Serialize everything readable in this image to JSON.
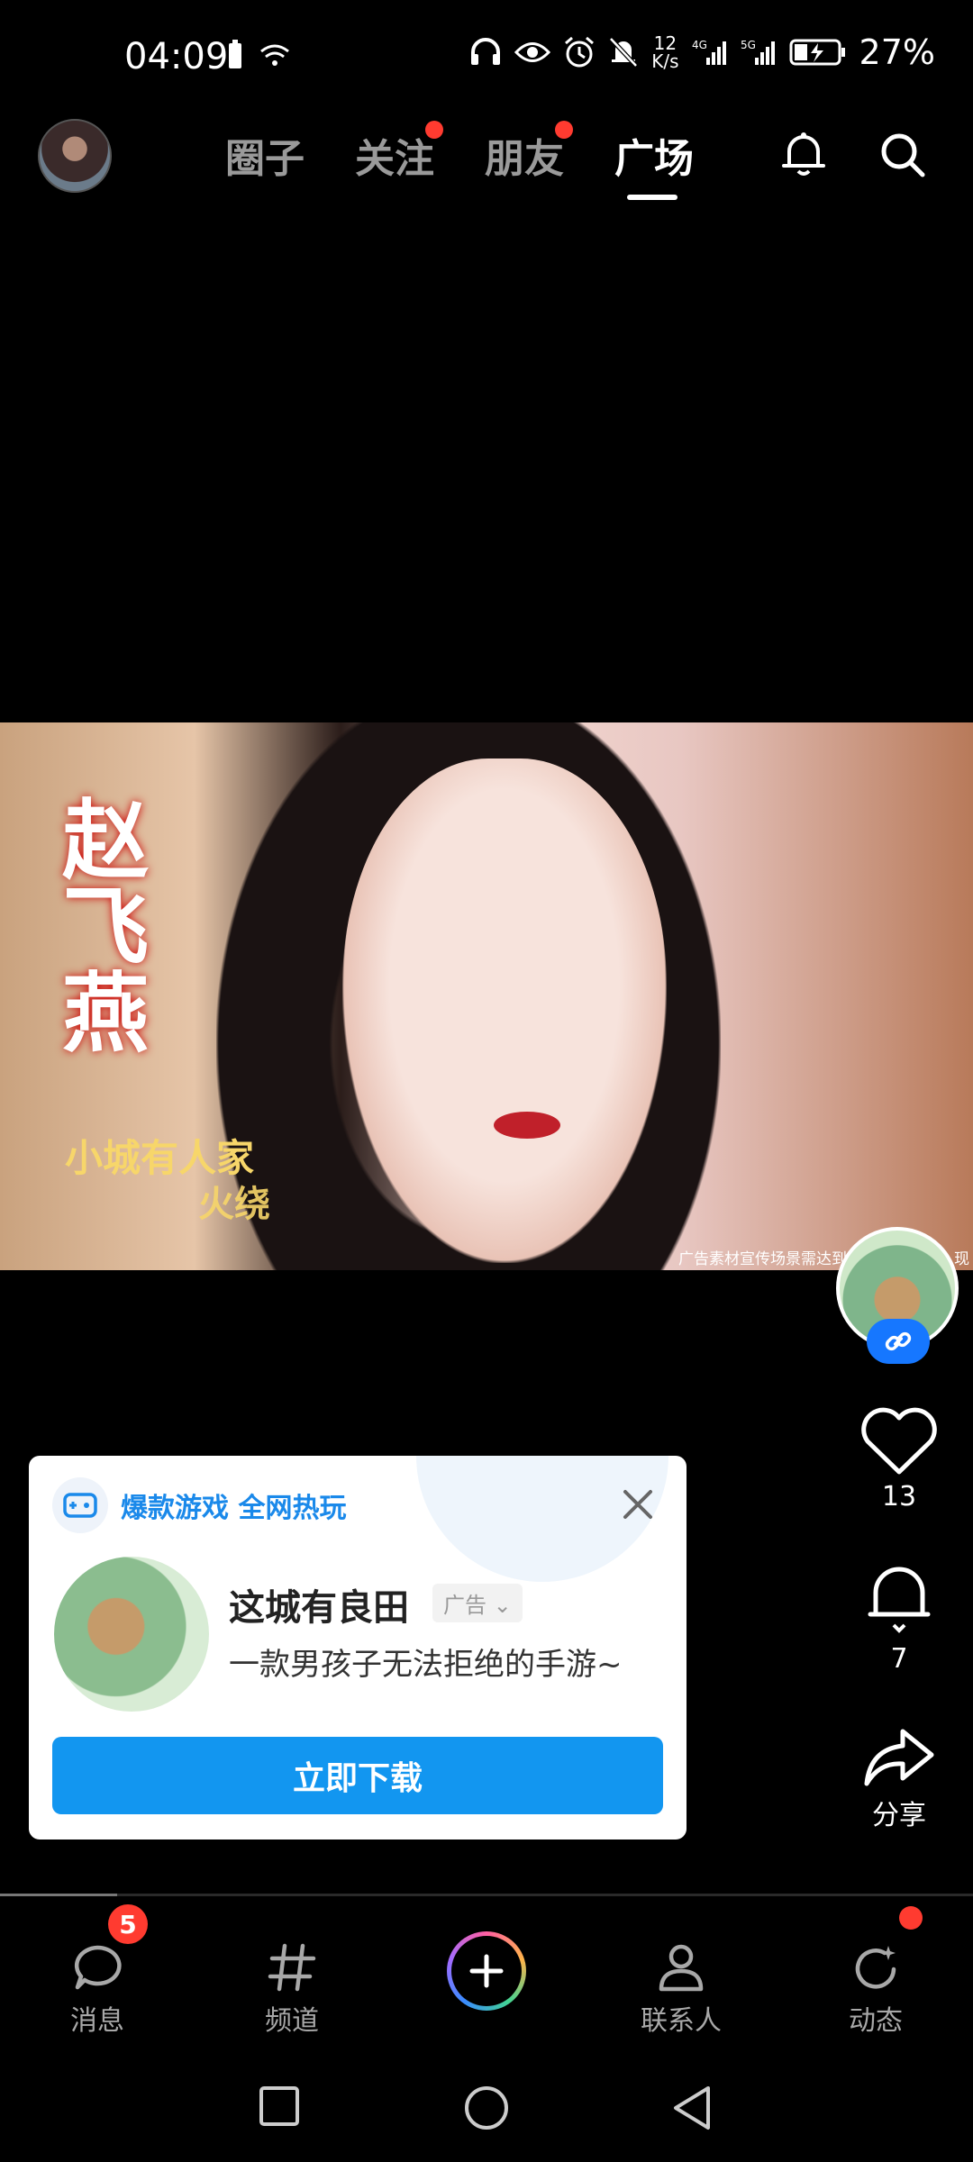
{
  "status_bar": {
    "time": "04:09",
    "net_speed_top": "12",
    "net_speed_unit": "K/s",
    "battery": "27%"
  },
  "top_nav": {
    "tabs": [
      {
        "label": "圈子",
        "active": false,
        "dot": false
      },
      {
        "label": "关注",
        "active": false,
        "dot": true
      },
      {
        "label": "朋友",
        "active": false,
        "dot": true
      },
      {
        "label": "广场",
        "active": true,
        "dot": false
      }
    ]
  },
  "media": {
    "title": "赵飞燕",
    "subtitle1": "小城有人家",
    "subtitle2": "火绕",
    "disclaimer": "广告素材宣传场景需达到一定关卡或解…现"
  },
  "rail": {
    "like_count": "13",
    "comment_count": "7",
    "share_label": "分享"
  },
  "ad": {
    "tag": "爆款游戏 全网热玩",
    "app_name": "这城有良田",
    "badge": "广告",
    "description": "一款男孩子无法拒绝的手游~",
    "button": "立即下载"
  },
  "video_progress": 0.12,
  "bottom_tabs": {
    "messages": "消息",
    "messages_badge": "5",
    "channels": "频道",
    "contacts": "联系人",
    "dynamics": "动态"
  },
  "colors": {
    "accent": "#1296f0",
    "tag_blue": "#1a89ea",
    "badge_red": "#ff3b30"
  }
}
